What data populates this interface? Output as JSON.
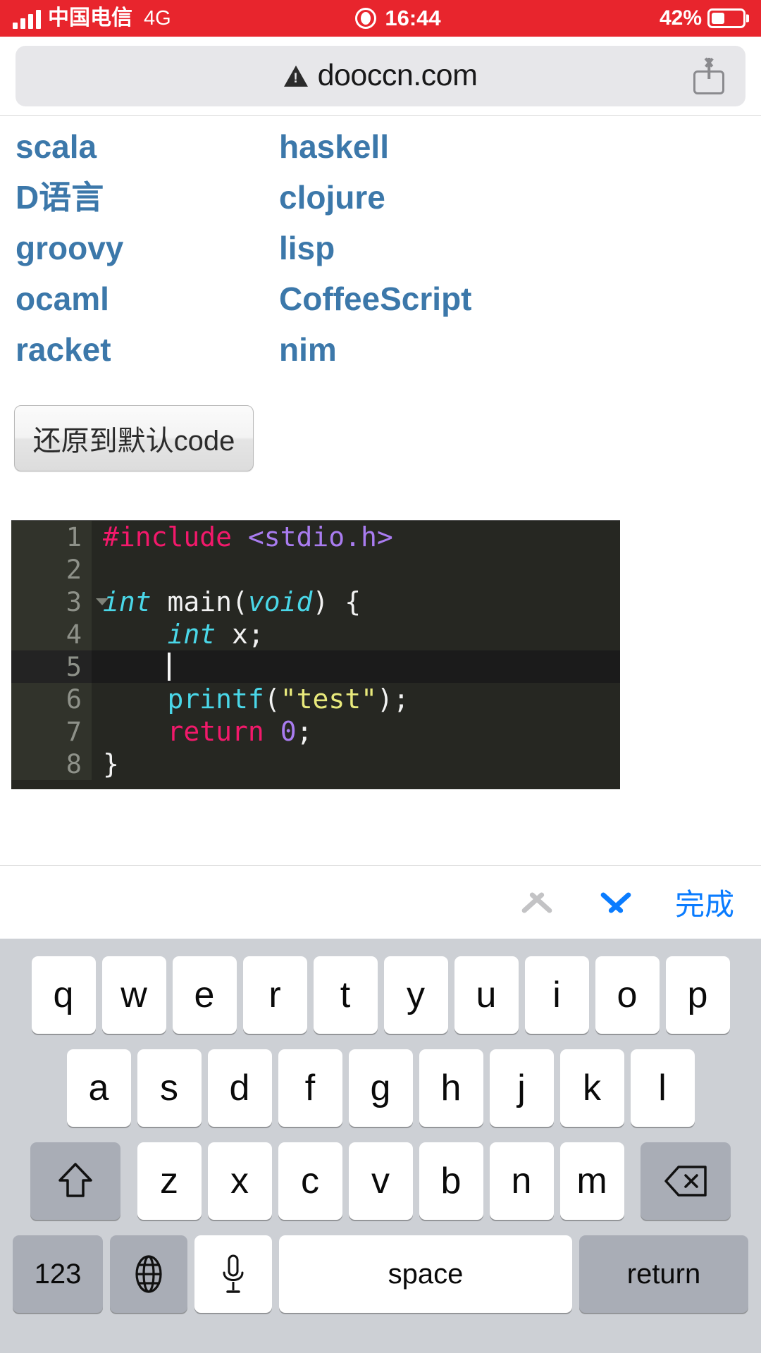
{
  "status_bar": {
    "carrier": "中国电信",
    "network": "4G",
    "time": "16:44",
    "battery_percent": "42%",
    "background_color": "#e8252d",
    "recording_icon": "record-indicator-icon"
  },
  "browser": {
    "url": "dooccn.com",
    "warning_icon": "insecure-warning-icon",
    "share_icon": "share-icon"
  },
  "page": {
    "language_links": [
      {
        "left": "scala",
        "right": "haskell"
      },
      {
        "left": "D语言",
        "right": "clojure"
      },
      {
        "left": "groovy",
        "right": "lisp"
      },
      {
        "left": "ocaml",
        "right": "CoffeeScript"
      },
      {
        "left": "racket",
        "right": "nim"
      }
    ],
    "reset_button_label": "还原到默认code"
  },
  "editor": {
    "lines": [
      {
        "num": "1",
        "fold": false,
        "active": false,
        "tokens": [
          {
            "t": "#include ",
            "c": "tk-pre"
          },
          {
            "t": "<stdio.h>",
            "c": "tk-inc"
          }
        ]
      },
      {
        "num": "2",
        "fold": false,
        "active": false,
        "tokens": []
      },
      {
        "num": "3",
        "fold": true,
        "active": false,
        "tokens": [
          {
            "t": "int",
            "c": "tk-type"
          },
          {
            "t": " main(",
            "c": "tk-pl"
          },
          {
            "t": "void",
            "c": "tk-type"
          },
          {
            "t": ") {",
            "c": "tk-pl"
          }
        ]
      },
      {
        "num": "4",
        "fold": false,
        "active": false,
        "tokens": [
          {
            "t": "    ",
            "c": "tk-pl"
          },
          {
            "t": "int",
            "c": "tk-type"
          },
          {
            "t": " x;",
            "c": "tk-pl"
          }
        ]
      },
      {
        "num": "5",
        "fold": false,
        "active": true,
        "caret": true,
        "tokens": [
          {
            "t": "    ",
            "c": "tk-pl"
          }
        ]
      },
      {
        "num": "6",
        "fold": false,
        "active": false,
        "tokens": [
          {
            "t": "    ",
            "c": "tk-pl"
          },
          {
            "t": "printf",
            "c": "tk-fn"
          },
          {
            "t": "(",
            "c": "tk-pl"
          },
          {
            "t": "\"test\"",
            "c": "tk-str"
          },
          {
            "t": ");",
            "c": "tk-pl"
          }
        ]
      },
      {
        "num": "7",
        "fold": false,
        "active": false,
        "tokens": [
          {
            "t": "    ",
            "c": "tk-pl"
          },
          {
            "t": "return",
            "c": "tk-kw"
          },
          {
            "t": " ",
            "c": "tk-pl"
          },
          {
            "t": "0",
            "c": "tk-num"
          },
          {
            "t": ";",
            "c": "tk-pl"
          }
        ]
      },
      {
        "num": "8",
        "fold": false,
        "active": false,
        "tokens": [
          {
            "t": "}",
            "c": "tk-pl"
          }
        ]
      }
    ],
    "theme": {
      "background": "#262722",
      "gutter_background": "#31332b",
      "active_line_background": "#1b1b1b",
      "line_number_color": "#8e9189",
      "preprocessor_color": "#f2196b",
      "include_path_color": "#a97cf0",
      "type_color": "#4ad7e8",
      "string_color": "#e9ea7c",
      "keyword_color": "#f2196b",
      "number_color": "#a97cf0",
      "plain_color": "#f2f2f2"
    }
  },
  "accessory_bar": {
    "prev_icon": "chevron-up-icon",
    "next_icon": "chevron-down-icon",
    "done_label": "完成",
    "prev_enabled_color": "#c3c3c5",
    "next_enabled_color": "#0a7cff",
    "done_color": "#0a7cff"
  },
  "keyboard": {
    "row1": [
      "q",
      "w",
      "e",
      "r",
      "t",
      "y",
      "u",
      "i",
      "o",
      "p"
    ],
    "row2": [
      "a",
      "s",
      "d",
      "f",
      "g",
      "h",
      "j",
      "k",
      "l"
    ],
    "row3": [
      "z",
      "x",
      "c",
      "v",
      "b",
      "n",
      "m"
    ],
    "shift_icon": "shift-icon",
    "backspace_icon": "backspace-icon",
    "numbers_label": "123",
    "globe_icon": "globe-icon",
    "mic_icon": "microphone-icon",
    "space_label": "space",
    "return_label": "return",
    "background_color": "#cdd0d5"
  }
}
